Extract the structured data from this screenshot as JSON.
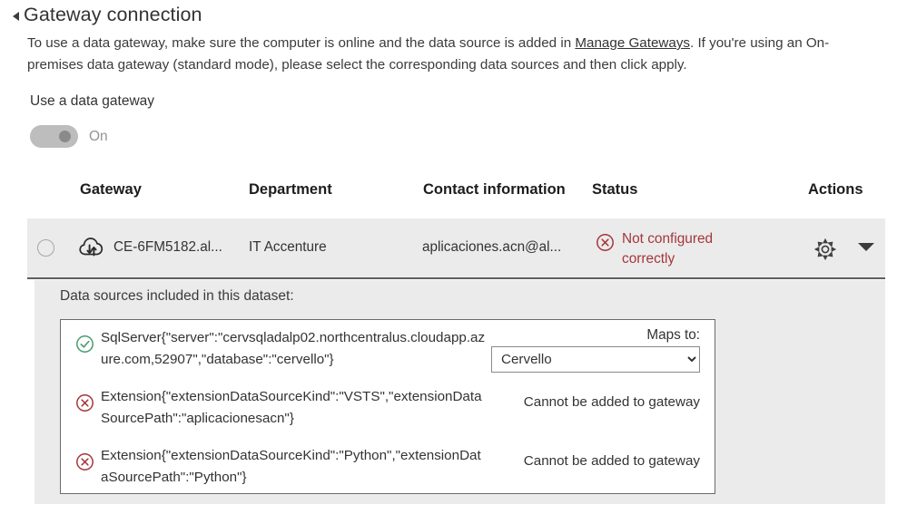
{
  "section": {
    "title": "Gateway connection",
    "collapse_icon": "triangle-collapse-icon",
    "description_part1": "To use a data gateway, make sure the computer is online and the data source is added in ",
    "description_link": "Manage Gateways",
    "description_part2": ". If you're using an On-premises data gateway (standard mode), please select the corresponding data sources and then click apply."
  },
  "toggle": {
    "label": "Use a data gateway",
    "state": "On"
  },
  "table": {
    "headers": {
      "gateway": "Gateway",
      "department": "Department",
      "contact": "Contact information",
      "status": "Status",
      "actions": "Actions"
    },
    "row": {
      "gateway_icon": "cloud-sync-icon",
      "gateway": "CE-6FM5182.al...",
      "department": "IT Accenture",
      "contact": "aplicaciones.acn@al...",
      "status_icon": "error-x-circle-icon",
      "status": "Not configured correctly",
      "status_color": "#a4373a",
      "gear_icon": "gear-icon",
      "chevron_icon": "chevron-down-icon"
    }
  },
  "data_sources": {
    "heading": "Data sources included in this dataset:",
    "maps_to_label": "Maps to:",
    "items": [
      {
        "status_icon": "success-check-circle-icon",
        "icon_color": "#4a9c6d",
        "text": "SqlServer{\"server\":\"cervsqladalp02.northcentralus.cloudapp.azure.com,52907\",\"database\":\"cervello\"}",
        "action_type": "select",
        "selected_option": "Cervello",
        "options": [
          "Cervello"
        ]
      },
      {
        "status_icon": "error-x-circle-icon",
        "icon_color": "#a4373a",
        "text": "Extension{\"extensionDataSourceKind\":\"VSTS\",\"extensionDataSourcePath\":\"aplicacionesacn\"}",
        "action_type": "message",
        "message": "Cannot be added to gateway"
      },
      {
        "status_icon": "error-x-circle-icon",
        "icon_color": "#a4373a",
        "text": "Extension{\"extensionDataSourceKind\":\"Python\",\"extensionDataSourcePath\":\"Python\"}",
        "action_type": "message",
        "message": "Cannot be added to gateway"
      }
    ]
  }
}
